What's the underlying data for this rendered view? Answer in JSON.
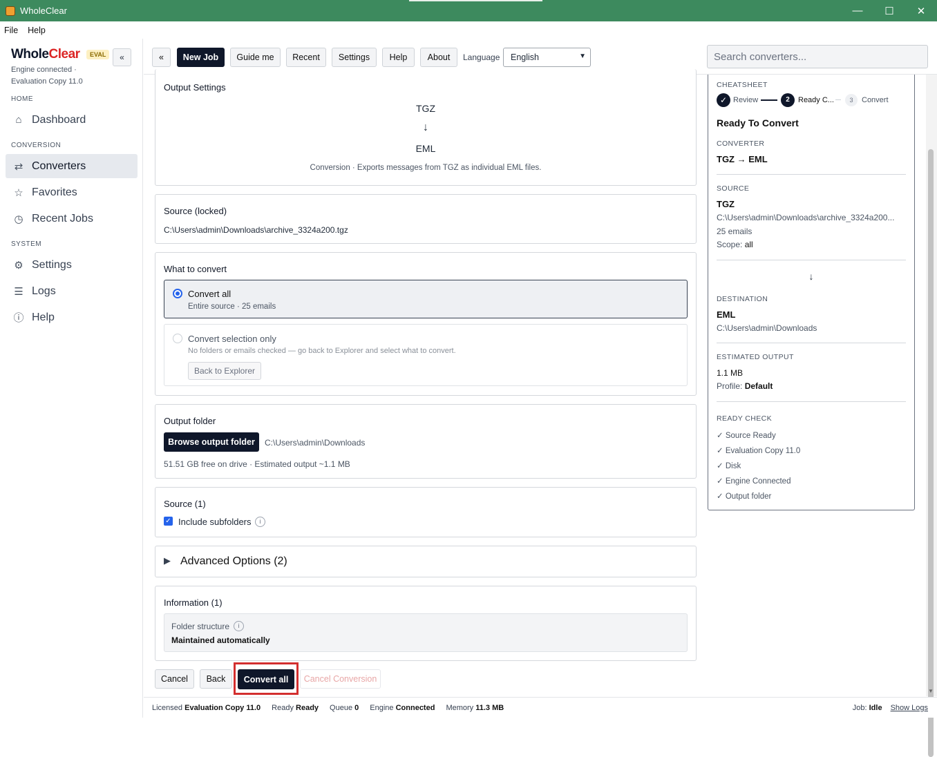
{
  "window": {
    "title": "WholeClear",
    "minimize": "—",
    "maximize": "☐",
    "close": "✕"
  },
  "menu": {
    "file": "File",
    "help": "Help"
  },
  "sidebar": {
    "logo_main": "Whole",
    "logo_accent": "Clear",
    "badge": "EVAL",
    "collapse": "«",
    "engine_status": "Engine connected ·",
    "license": "Evaluation Copy 11.0",
    "sections": {
      "home": "HOME",
      "conversion": "CONVERSION",
      "system": "SYSTEM"
    },
    "items": [
      {
        "label": "Dashboard",
        "icon": "⌂"
      },
      {
        "label": "Converters",
        "icon": "⇄"
      },
      {
        "label": "Favorites",
        "icon": "☆"
      },
      {
        "label": "Recent Jobs",
        "icon": "◷"
      },
      {
        "label": "Settings",
        "icon": "⚙"
      },
      {
        "label": "Logs",
        "icon": "☰"
      },
      {
        "label": "Help",
        "icon": "ⓘ"
      }
    ]
  },
  "toolbar": {
    "back": "«",
    "new_job": "New Job",
    "guide": "Guide me",
    "recent": "Recent",
    "settings": "Settings",
    "help": "Help",
    "about": "About",
    "language_label": "Language",
    "language_value": "English",
    "search_placeholder": "Search converters..."
  },
  "output_settings": {
    "title": "Output Settings",
    "from": "TGZ",
    "arrow": "↓",
    "to": "EML",
    "description": "Conversion · Exports messages from TGZ as individual EML files."
  },
  "source_locked": {
    "title": "Source (locked)",
    "path": "C:\\Users\\admin\\Downloads\\archive_3324a200.tgz"
  },
  "what_to_convert": {
    "title": "What to convert",
    "all_label": "Convert all",
    "all_desc": "Entire source · 25 emails",
    "sel_label": "Convert selection only",
    "sel_desc": "No folders or emails checked — go back to Explorer and select what to convert.",
    "back_explorer": "Back to Explorer"
  },
  "output_folder": {
    "title": "Output folder",
    "browse": "Browse output folder",
    "path": "C:\\Users\\admin\\Downloads",
    "info": "51.51 GB free on drive · Estimated output ~1.1 MB"
  },
  "source": {
    "title": "Source (1)",
    "include_subfolders": "Include subfolders",
    "checked": true
  },
  "advanced": {
    "title": "Advanced Options (2)"
  },
  "information": {
    "title": "Information (1)",
    "label": "Folder structure",
    "value": "Maintained automatically"
  },
  "actions": {
    "cancel": "Cancel",
    "back": "Back",
    "convert": "Convert all",
    "cancel_conversion": "Cancel Conversion"
  },
  "cheatsheet": {
    "title": "CHEATSHEET",
    "step1": "Review",
    "step2_num": "2",
    "step2": "Ready C...",
    "step3_num": "3",
    "step3": "Convert",
    "heading": "Ready To Convert",
    "converter_label": "CONVERTER",
    "converter": "TGZ → EML",
    "source_label": "SOURCE",
    "source_fmt": "TGZ",
    "source_path": "C:\\Users\\admin\\Downloads\\archive_3324a200...",
    "source_count": "25 emails",
    "scope_label": "Scope:",
    "scope": "all",
    "arrow": "↓",
    "dest_label": "DESTINATION",
    "dest_fmt": "EML",
    "dest_path": "C:\\Users\\admin\\Downloads",
    "est_label": "ESTIMATED OUTPUT",
    "est_size": "1.1 MB",
    "profile_label": "Profile:",
    "profile": "Default",
    "ready_label": "READY CHECK",
    "checks": [
      "✓ Source Ready",
      "✓ Evaluation Copy 11.0",
      "✓ Disk",
      "✓ Engine Connected",
      "✓ Output folder"
    ]
  },
  "status": {
    "licensed_label": "Licensed",
    "licensed": "Evaluation Copy 11.0",
    "ready_label": "Ready",
    "ready": "Ready",
    "queue_label": "Queue",
    "queue": "0",
    "engine_label": "Engine",
    "engine": "Connected",
    "memory_label": "Memory",
    "memory": "11.3 MB",
    "job_label": "Job:",
    "job": "Idle",
    "show_logs": "Show Logs"
  }
}
